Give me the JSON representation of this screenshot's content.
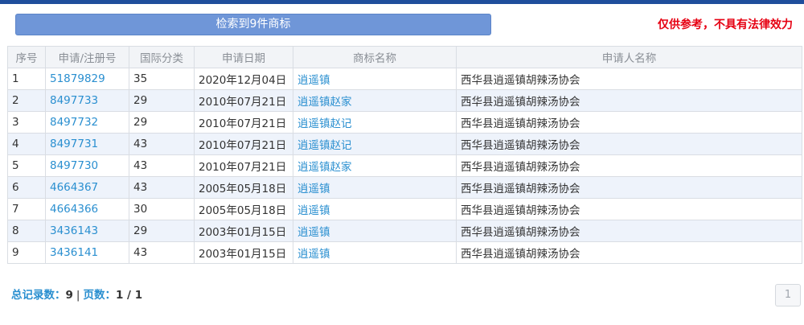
{
  "header": {
    "result_button": "检索到9件商标",
    "disclaimer": "仅供参考，不具有法律效力"
  },
  "table": {
    "columns": [
      "序号",
      "申请/注册号",
      "国际分类",
      "申请日期",
      "商标名称",
      "申请人名称"
    ],
    "rows": [
      {
        "seq": "1",
        "reg_no": "51879829",
        "class": "35",
        "date": "2020年12月04日",
        "name": "逍遥镇",
        "applicant": "西华县逍遥镇胡辣汤协会"
      },
      {
        "seq": "2",
        "reg_no": "8497733",
        "class": "29",
        "date": "2010年07月21日",
        "name": "逍遥镇赵家",
        "applicant": "西华县逍遥镇胡辣汤协会"
      },
      {
        "seq": "3",
        "reg_no": "8497732",
        "class": "29",
        "date": "2010年07月21日",
        "name": "逍遥镇赵记",
        "applicant": "西华县逍遥镇胡辣汤协会"
      },
      {
        "seq": "4",
        "reg_no": "8497731",
        "class": "43",
        "date": "2010年07月21日",
        "name": "逍遥镇赵记",
        "applicant": "西华县逍遥镇胡辣汤协会"
      },
      {
        "seq": "5",
        "reg_no": "8497730",
        "class": "43",
        "date": "2010年07月21日",
        "name": "逍遥镇赵家",
        "applicant": "西华县逍遥镇胡辣汤协会"
      },
      {
        "seq": "6",
        "reg_no": "4664367",
        "class": "43",
        "date": "2005年05月18日",
        "name": "逍遥镇",
        "applicant": "西华县逍遥镇胡辣汤协会"
      },
      {
        "seq": "7",
        "reg_no": "4664366",
        "class": "30",
        "date": "2005年05月18日",
        "name": "逍遥镇",
        "applicant": "西华县逍遥镇胡辣汤协会"
      },
      {
        "seq": "8",
        "reg_no": "3436143",
        "class": "29",
        "date": "2003年01月15日",
        "name": "逍遥镇",
        "applicant": "西华县逍遥镇胡辣汤协会"
      },
      {
        "seq": "9",
        "reg_no": "3436141",
        "class": "43",
        "date": "2003年01月15日",
        "name": "逍遥镇",
        "applicant": "西华县逍遥镇胡辣汤协会"
      }
    ]
  },
  "footer": {
    "total_label": "总记录数：",
    "total_value": "9",
    "separator": "|",
    "pages_label": "页数：",
    "pages_value": "1 / 1",
    "page_button": "1"
  },
  "colors": {
    "top_bar": "#1f4e9c",
    "result_button_bg": "#6f96d8",
    "disclaimer": "#e60012",
    "link": "#2a8fd0",
    "row_alt": "#eef3fb"
  }
}
